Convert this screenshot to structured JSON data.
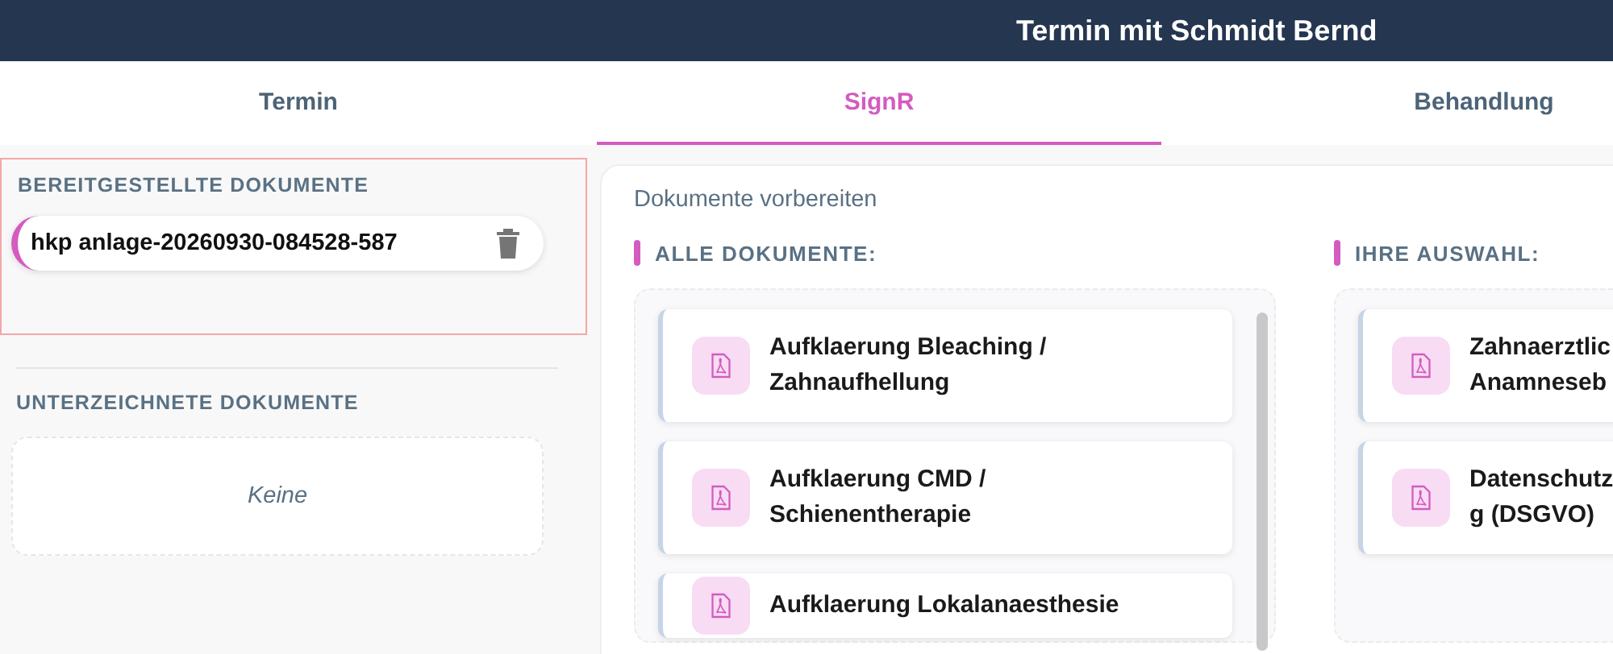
{
  "header": {
    "title": "Termin mit Schmidt Bernd"
  },
  "tabs": [
    {
      "label": "Termin",
      "selected": false
    },
    {
      "label": "SignR",
      "selected": true
    },
    {
      "label": "Behandlung",
      "selected": false
    }
  ],
  "sidebar": {
    "provided": {
      "heading": "BEREITGESTELLTE DOKUMENTE",
      "items": [
        {
          "name": "hkp anlage-20260930-084528-587"
        }
      ]
    },
    "signed": {
      "heading": "UNTERZEICHNETE DOKUMENTE",
      "empty_text": "Keine"
    }
  },
  "prepare": {
    "title": "Dokumente vorbereiten",
    "all": {
      "heading": "ALLE DOKUMENTE:",
      "items": [
        {
          "lines": [
            "Aufklaerung Bleaching /",
            "Zahnaufhellung"
          ]
        },
        {
          "lines": [
            "Aufklaerung CMD /",
            "Schienentherapie"
          ]
        },
        {
          "lines": [
            "Aufklaerung Lokalanaesthesie"
          ]
        }
      ]
    },
    "selection": {
      "heading": "IHRE AUSWAHL:",
      "items": [
        {
          "lines": [
            "Zahnaerztlic",
            "Anamneseb"
          ]
        },
        {
          "lines": [
            "Datenschutz",
            "g (DSGVO)"
          ]
        }
      ]
    }
  }
}
